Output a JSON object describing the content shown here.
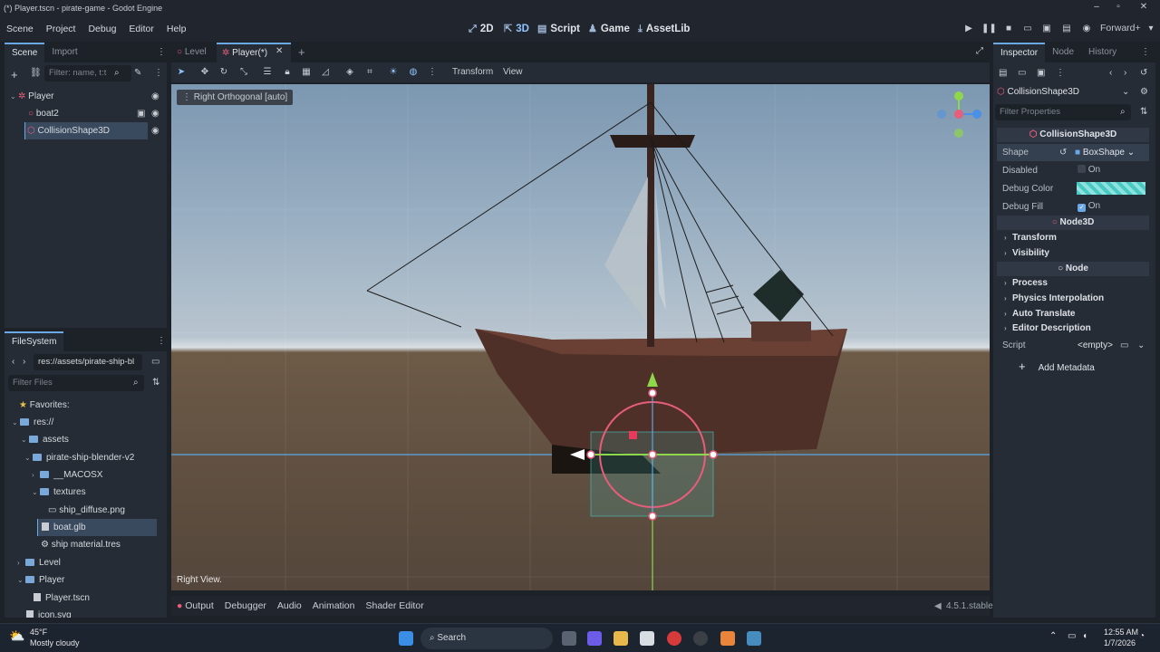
{
  "window": {
    "title": "(*) Player.tscn - pirate-game - Godot Engine"
  },
  "menu": [
    "Scene",
    "Project",
    "Debug",
    "Editor",
    "Help"
  ],
  "main_screens": {
    "2d": "2D",
    "3d": "3D",
    "script": "Script",
    "game": "Game",
    "assetlib": "AssetLib"
  },
  "renderer": "Forward+",
  "scene_panel": {
    "tabs": [
      "Scene",
      "Import"
    ],
    "filter_placeholder": "Filter: name, t:t",
    "nodes": [
      {
        "name": "Player",
        "icon": "node3d-icon"
      },
      {
        "name": "boat2",
        "icon": "node3d-icon"
      },
      {
        "name": "CollisionShape3D",
        "icon": "collision-shape-icon",
        "selected": true
      }
    ]
  },
  "filesystem": {
    "title": "FileSystem",
    "path": "res://assets/pirate-ship-bl",
    "filter_placeholder": "Filter Files",
    "items": [
      {
        "label": "Favorites:",
        "depth": 0,
        "kind": "star"
      },
      {
        "label": "res://",
        "depth": 0,
        "kind": "folder"
      },
      {
        "label": "assets",
        "depth": 1,
        "kind": "folder"
      },
      {
        "label": "pirate-ship-blender-v2",
        "depth": 2,
        "kind": "folder"
      },
      {
        "label": "__MACOSX",
        "depth": 3,
        "kind": "folder"
      },
      {
        "label": "textures",
        "depth": 3,
        "kind": "folder"
      },
      {
        "label": "ship_diffuse.png",
        "depth": 4,
        "kind": "image"
      },
      {
        "label": "boat.glb",
        "depth": 3,
        "kind": "scene",
        "selected": true
      },
      {
        "label": "ship material.tres",
        "depth": 3,
        "kind": "resource"
      },
      {
        "label": "Level",
        "depth": 1,
        "kind": "folder"
      },
      {
        "label": "Player",
        "depth": 1,
        "kind": "folder"
      },
      {
        "label": "Player.tscn",
        "depth": 2,
        "kind": "scene"
      },
      {
        "label": "icon.svg",
        "depth": 1,
        "kind": "image"
      }
    ]
  },
  "editor_tabs": [
    {
      "label": "Level",
      "active": false
    },
    {
      "label": "Player(*)",
      "active": true
    }
  ],
  "viewport": {
    "toolbar_menus": {
      "transform": "Transform",
      "view": "View"
    },
    "projection_label": "Right Orthogonal [auto]",
    "view_name": "Right View."
  },
  "inspector": {
    "tabs": [
      "Inspector",
      "Node",
      "History"
    ],
    "node_name": "CollisionShape3D",
    "filter_placeholder": "Filter Properties",
    "class_header": "CollisionShape3D",
    "properties": {
      "shape": {
        "label": "Shape",
        "value": "BoxShape"
      },
      "disabled": {
        "label": "Disabled",
        "value": "On",
        "checked": false
      },
      "debug_color": {
        "label": "Debug Color",
        "value_color": "#48c9c3"
      },
      "debug_fill": {
        "label": "Debug Fill",
        "value": "On",
        "checked": true
      }
    },
    "node3d_header": "Node3D",
    "node3d_sections": [
      "Transform",
      "Visibility"
    ],
    "node_header": "Node",
    "node_sections": [
      "Process",
      "Physics Interpolation",
      "Auto Translate",
      "Editor Description"
    ],
    "script": {
      "label": "Script",
      "value": "<empty>"
    },
    "add_metadata": "Add Metadata"
  },
  "bottom_panel": {
    "tabs": [
      "Output",
      "Debugger",
      "Audio",
      "Animation",
      "Shader Editor"
    ],
    "version": "4.5.1.stable"
  },
  "taskbar": {
    "weather_temp": "45°F",
    "weather_desc": "Mostly cloudy",
    "search": "Search",
    "time": "12:55 AM",
    "date": "1/7/2026"
  },
  "colors": {
    "accent": "#6ba8e6",
    "gizmo_y": "#8ed64a",
    "gizmo_z": "#4a8fe8",
    "selection": "#e85d7a"
  }
}
